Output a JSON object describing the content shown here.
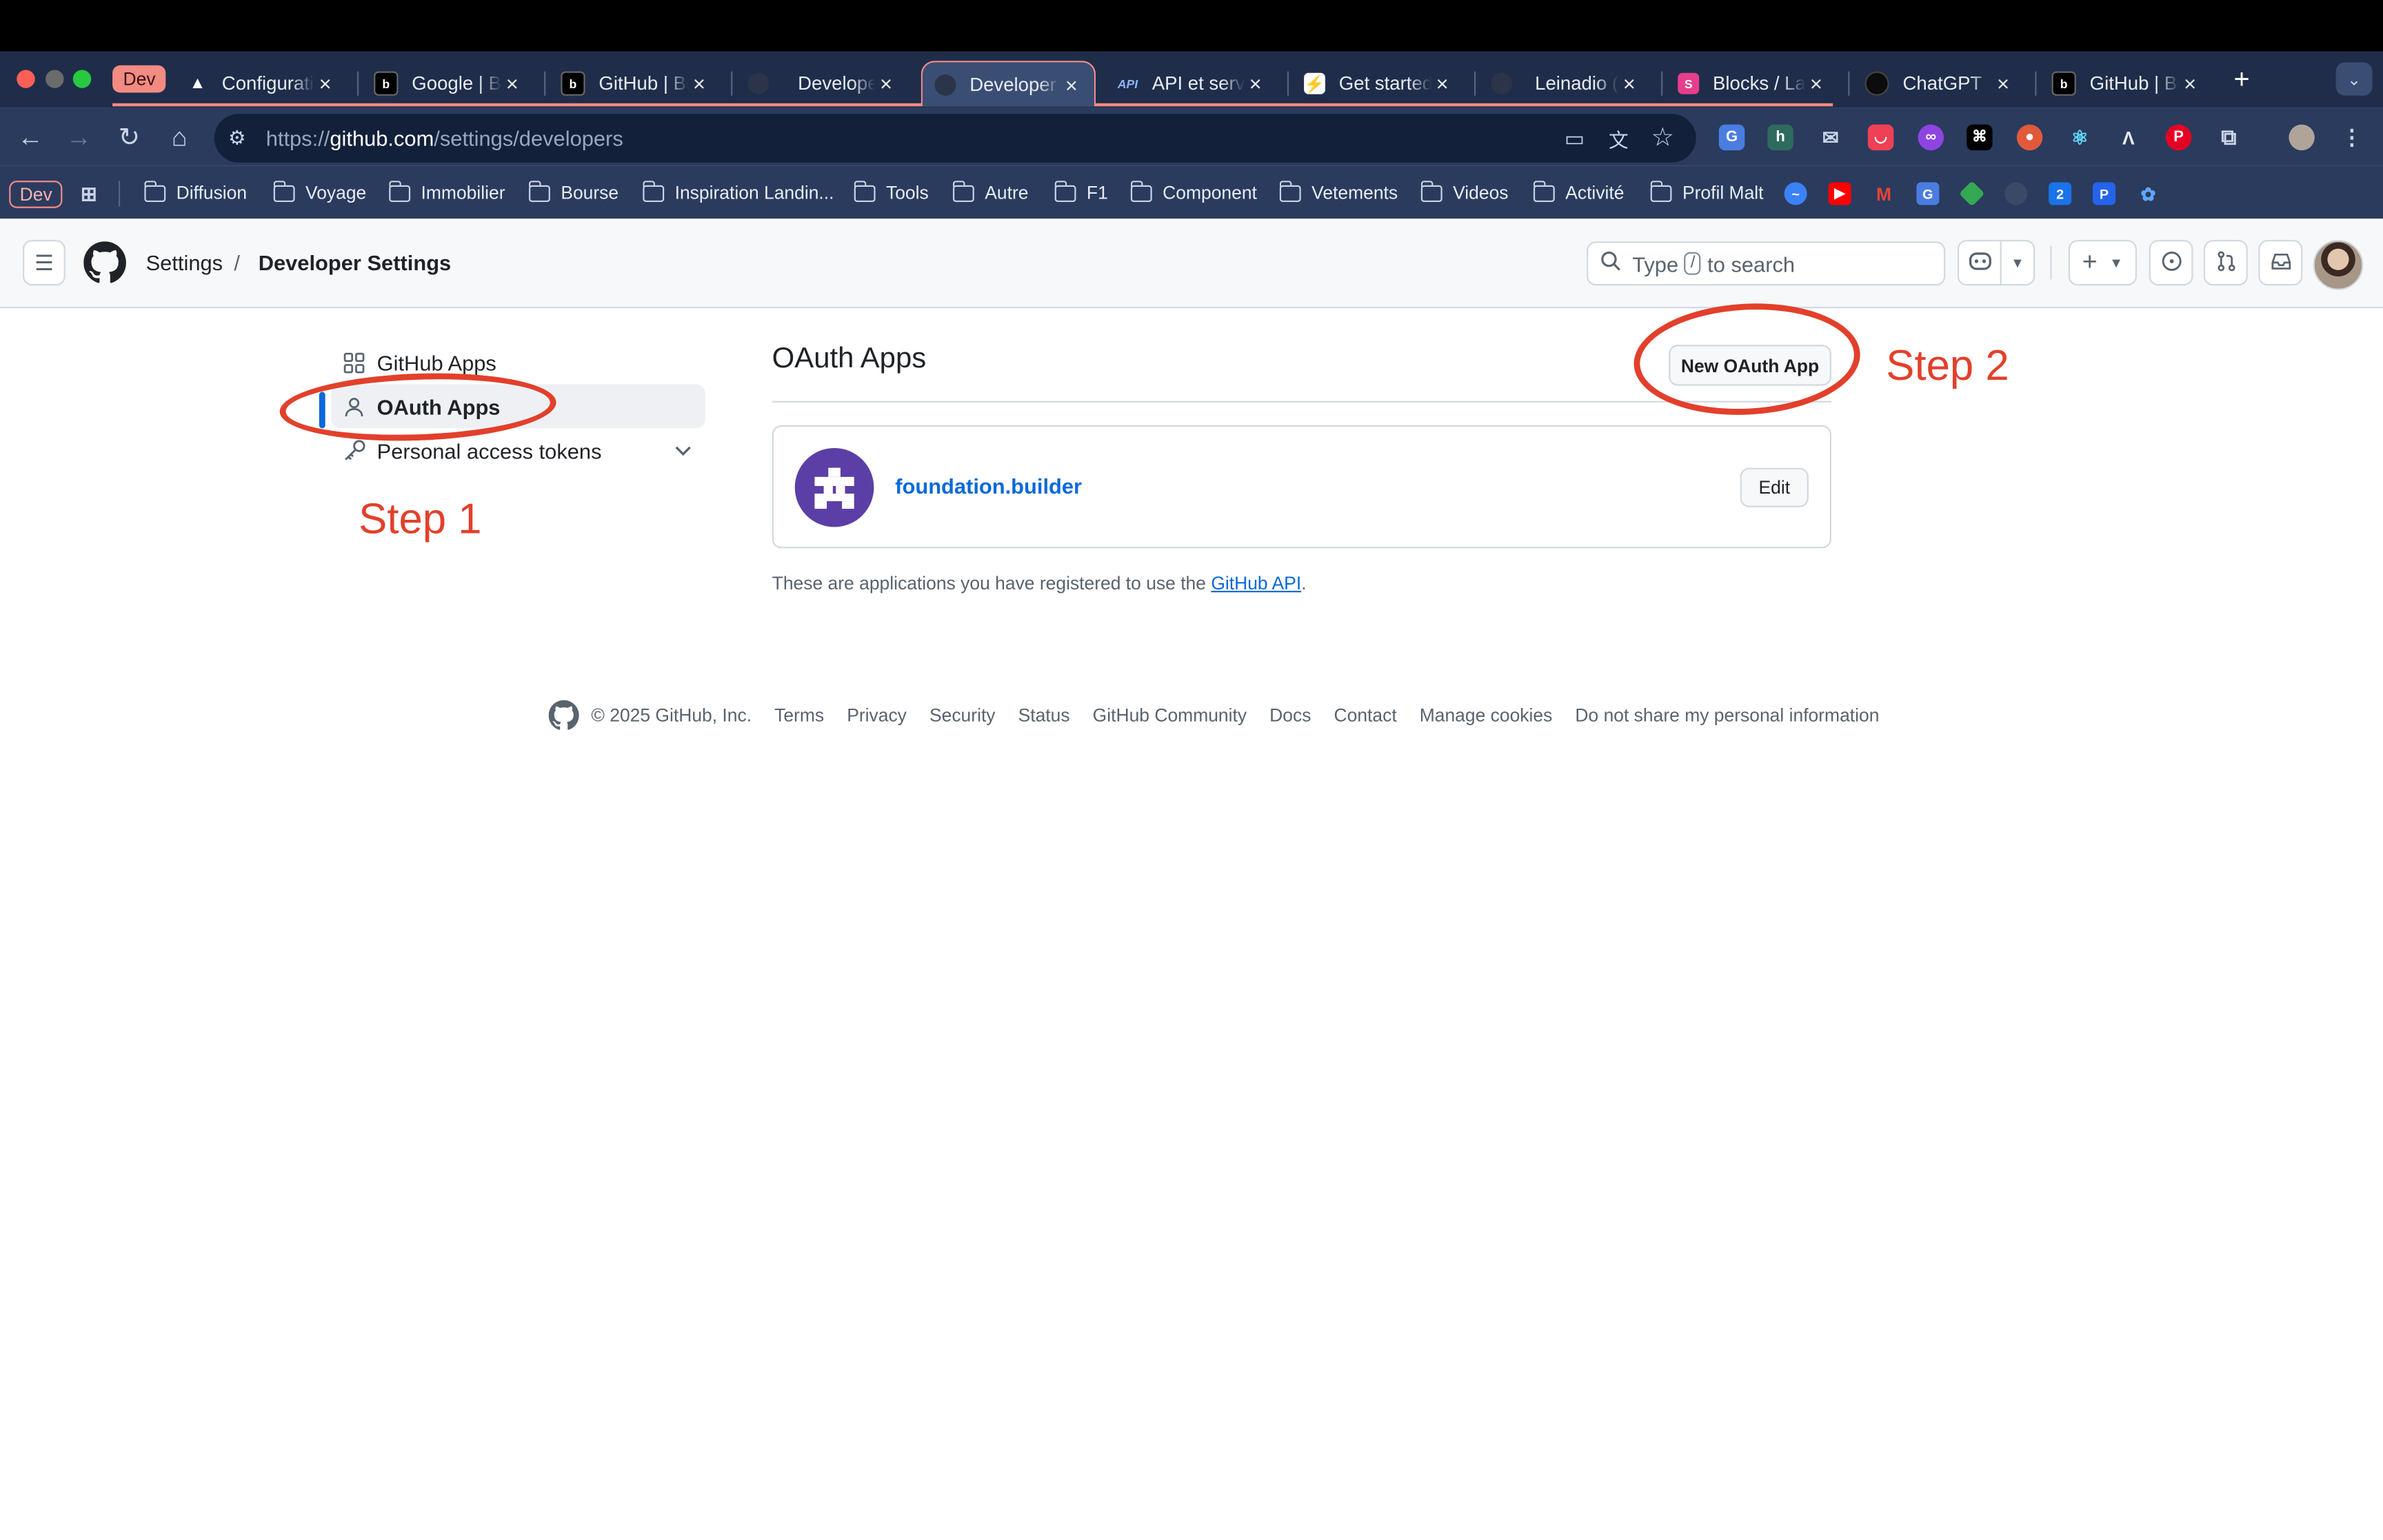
{
  "browser": {
    "tab_group_label": "Dev",
    "tabs": [
      {
        "title": "Configuration",
        "favicon": "triangle-icon"
      },
      {
        "title": "Google | Better Auth",
        "favicon": "better-auth-icon"
      },
      {
        "title": "GitHub | Better Auth",
        "favicon": "better-auth-icon"
      },
      {
        "title": "Developer applications",
        "favicon": "github-icon"
      },
      {
        "title": "Developer applications",
        "favicon": "github-icon",
        "active": true
      },
      {
        "title": "API et services",
        "favicon": "api-icon"
      },
      {
        "title": "Get started",
        "favicon": "bolt-icon"
      },
      {
        "title": "Leinadio (Daniel)",
        "favicon": "github-icon"
      },
      {
        "title": "Blocks / Laravel",
        "favicon": "s-icon"
      },
      {
        "title": "ChatGPT",
        "favicon": "openai-icon"
      },
      {
        "title": "GitHub | Better Auth",
        "favicon": "better-auth-icon"
      }
    ],
    "url_scheme": "https://",
    "url_host": "github.com",
    "url_path": "/settings/developers",
    "bookmarks": {
      "group": "Dev",
      "folders": [
        "Diffusion",
        "Voyage",
        "Immobilier",
        "Bourse",
        "Inspiration Landin...",
        "Tools",
        "Autre",
        "F1",
        "Component",
        "Vetements",
        "Videos",
        "Activité",
        "Profil Malt"
      ]
    }
  },
  "header": {
    "breadcrumb_root": "Settings",
    "breadcrumb_separator": "/",
    "breadcrumb_current": "Developer Settings",
    "search_prefix": "Type",
    "search_key": "/",
    "search_suffix": "to search"
  },
  "sidebar": {
    "items": [
      {
        "label": "GitHub Apps",
        "icon": "apps-grid-icon"
      },
      {
        "label": "OAuth Apps",
        "icon": "person-icon",
        "selected": true
      },
      {
        "label": "Personal access tokens",
        "icon": "key-icon"
      }
    ]
  },
  "main": {
    "title": "OAuth Apps",
    "new_button": "New OAuth App",
    "apps": [
      {
        "name": "foundation.builder",
        "edit_label": "Edit"
      }
    ],
    "note_prefix": "These are applications you have registered to use the ",
    "note_link": "GitHub API",
    "note_suffix": "."
  },
  "annotations": {
    "step1": "Step 1",
    "step2": "Step 2",
    "color": "#e2402b"
  },
  "footer": {
    "copyright": "© 2025 GitHub, Inc.",
    "links": [
      "Terms",
      "Privacy",
      "Security",
      "Status",
      "GitHub Community",
      "Docs",
      "Contact",
      "Manage cookies",
      "Do not share my personal information"
    ]
  },
  "colors": {
    "accent": "#0969da",
    "app_logo": "#5b3fa6",
    "tab_bar": "#1f2d4a",
    "toolbar": "#2a3b5e"
  }
}
